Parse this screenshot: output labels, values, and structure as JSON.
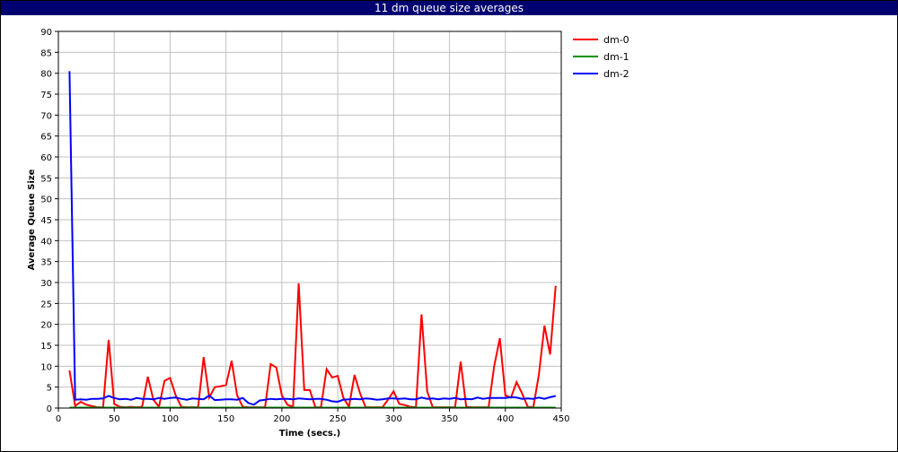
{
  "window": {
    "title": "11 dm queue size averages"
  },
  "chart_data": {
    "type": "line",
    "title": "11 dm queue size averages",
    "xlabel": "Time (secs.)",
    "ylabel": "Average Queue Size",
    "xlim": [
      0,
      450
    ],
    "ylim": [
      0,
      90
    ],
    "xticks": [
      0,
      50,
      100,
      150,
      200,
      250,
      300,
      350,
      400,
      450
    ],
    "yticks": [
      0,
      5,
      10,
      15,
      20,
      25,
      30,
      35,
      40,
      45,
      50,
      55,
      60,
      65,
      70,
      75,
      80,
      85,
      90
    ],
    "grid": true,
    "legend_position": "right",
    "series": [
      {
        "name": "dm-0",
        "color": "#ff0000",
        "points": [
          [
            10,
            9
          ],
          [
            15,
            0.5
          ],
          [
            20,
            1.5
          ],
          [
            25,
            0.8
          ],
          [
            30,
            0.5
          ],
          [
            35,
            0.2
          ],
          [
            40,
            0.2
          ],
          [
            45,
            16.3
          ],
          [
            50,
            1
          ],
          [
            55,
            0.3
          ],
          [
            60,
            0.2
          ],
          [
            65,
            0.3
          ],
          [
            70,
            0.2
          ],
          [
            75,
            0.3
          ],
          [
            80,
            7.5
          ],
          [
            85,
            2
          ],
          [
            90,
            0.3
          ],
          [
            95,
            6.5
          ],
          [
            100,
            7.2
          ],
          [
            105,
            3
          ],
          [
            110,
            0.3
          ],
          [
            115,
            0.2
          ],
          [
            120,
            0.2
          ],
          [
            125,
            0.2
          ],
          [
            130,
            12.2
          ],
          [
            135,
            2.5
          ],
          [
            140,
            5
          ],
          [
            145,
            5.2
          ],
          [
            150,
            5.5
          ],
          [
            155,
            11.3
          ],
          [
            160,
            3
          ],
          [
            165,
            0.3
          ],
          [
            170,
            0.2
          ],
          [
            175,
            0.2
          ],
          [
            180,
            0.2
          ],
          [
            185,
            0.2
          ],
          [
            190,
            10.5
          ],
          [
            195,
            9.7
          ],
          [
            200,
            3
          ],
          [
            205,
            0.8
          ],
          [
            210,
            0.3
          ],
          [
            215,
            29.8
          ],
          [
            220,
            4.3
          ],
          [
            225,
            4.3
          ],
          [
            230,
            0.2
          ],
          [
            235,
            0.2
          ],
          [
            240,
            9.3
          ],
          [
            245,
            7.3
          ],
          [
            250,
            7.7
          ],
          [
            255,
            2.5
          ],
          [
            260,
            0.3
          ],
          [
            265,
            7.9
          ],
          [
            270,
            3.5
          ],
          [
            275,
            0.2
          ],
          [
            280,
            0.2
          ],
          [
            285,
            0.2
          ],
          [
            290,
            0.2
          ],
          [
            295,
            2
          ],
          [
            300,
            4
          ],
          [
            305,
            1
          ],
          [
            310,
            0.7
          ],
          [
            315,
            0.3
          ],
          [
            320,
            0.2
          ],
          [
            325,
            22.4
          ],
          [
            330,
            4
          ],
          [
            335,
            0.2
          ],
          [
            340,
            0.2
          ],
          [
            345,
            0.2
          ],
          [
            350,
            0.2
          ],
          [
            355,
            0.2
          ],
          [
            360,
            11.1
          ],
          [
            365,
            0.3
          ],
          [
            370,
            0.2
          ],
          [
            375,
            0.2
          ],
          [
            380,
            0.2
          ],
          [
            385,
            0.2
          ],
          [
            390,
            10
          ],
          [
            395,
            16.7
          ],
          [
            400,
            3
          ],
          [
            405,
            2.5
          ],
          [
            410,
            6.2
          ],
          [
            415,
            3.5
          ],
          [
            420,
            0.3
          ],
          [
            425,
            0.2
          ],
          [
            430,
            8
          ],
          [
            435,
            19.7
          ],
          [
            440,
            12.8
          ],
          [
            445,
            29.2
          ]
        ]
      },
      {
        "name": "dm-1",
        "color": "#009000",
        "points": [
          [
            10,
            0.1
          ],
          [
            445,
            0.1
          ]
        ]
      },
      {
        "name": "dm-2",
        "color": "#0000ff",
        "points": [
          [
            10,
            80.5
          ],
          [
            15,
            2
          ],
          [
            20,
            2.1
          ],
          [
            25,
            2
          ],
          [
            30,
            2.2
          ],
          [
            35,
            2.2
          ],
          [
            40,
            2.3
          ],
          [
            45,
            2.9
          ],
          [
            50,
            2.4
          ],
          [
            55,
            2.1
          ],
          [
            60,
            2.2
          ],
          [
            65,
            2
          ],
          [
            70,
            2.4
          ],
          [
            75,
            2.2
          ],
          [
            80,
            2.2
          ],
          [
            85,
            2.1
          ],
          [
            90,
            2.4
          ],
          [
            95,
            2.2
          ],
          [
            100,
            2.4
          ],
          [
            105,
            2.5
          ],
          [
            110,
            2.2
          ],
          [
            115,
            2
          ],
          [
            120,
            2.3
          ],
          [
            125,
            2.2
          ],
          [
            130,
            2.1
          ],
          [
            135,
            3
          ],
          [
            140,
            1.9
          ],
          [
            145,
            2
          ],
          [
            150,
            2.1
          ],
          [
            155,
            2.1
          ],
          [
            160,
            2
          ],
          [
            165,
            2.4
          ],
          [
            170,
            1.2
          ],
          [
            175,
            0.8
          ],
          [
            180,
            1.8
          ],
          [
            185,
            2
          ],
          [
            190,
            2.2
          ],
          [
            195,
            2.1
          ],
          [
            200,
            2.2
          ],
          [
            205,
            2.2
          ],
          [
            210,
            2.1
          ],
          [
            215,
            2.3
          ],
          [
            220,
            2.2
          ],
          [
            225,
            2.1
          ],
          [
            230,
            2.2
          ],
          [
            235,
            2.2
          ],
          [
            240,
            2
          ],
          [
            245,
            1.6
          ],
          [
            250,
            1.5
          ],
          [
            255,
            2
          ],
          [
            260,
            2.1
          ],
          [
            265,
            2.2
          ],
          [
            270,
            2.1
          ],
          [
            275,
            2.3
          ],
          [
            280,
            2.2
          ],
          [
            285,
            2
          ],
          [
            290,
            2.1
          ],
          [
            295,
            2.3
          ],
          [
            300,
            2.3
          ],
          [
            305,
            2.2
          ],
          [
            310,
            2.3
          ],
          [
            315,
            2.1
          ],
          [
            320,
            2.1
          ],
          [
            325,
            2.5
          ],
          [
            330,
            2.2
          ],
          [
            335,
            2.3
          ],
          [
            340,
            2.1
          ],
          [
            345,
            2.3
          ],
          [
            350,
            2.2
          ],
          [
            355,
            2.4
          ],
          [
            360,
            2.1
          ],
          [
            365,
            2.2
          ],
          [
            370,
            2.1
          ],
          [
            375,
            2.5
          ],
          [
            380,
            2.2
          ],
          [
            385,
            2.4
          ],
          [
            390,
            2.4
          ],
          [
            395,
            2.4
          ],
          [
            400,
            2.4
          ],
          [
            405,
            2.6
          ],
          [
            410,
            2.5
          ],
          [
            415,
            2.2
          ],
          [
            420,
            2.3
          ],
          [
            425,
            2.2
          ],
          [
            430,
            2.5
          ],
          [
            435,
            2.2
          ],
          [
            440,
            2.6
          ],
          [
            445,
            2.9
          ]
        ]
      }
    ]
  }
}
